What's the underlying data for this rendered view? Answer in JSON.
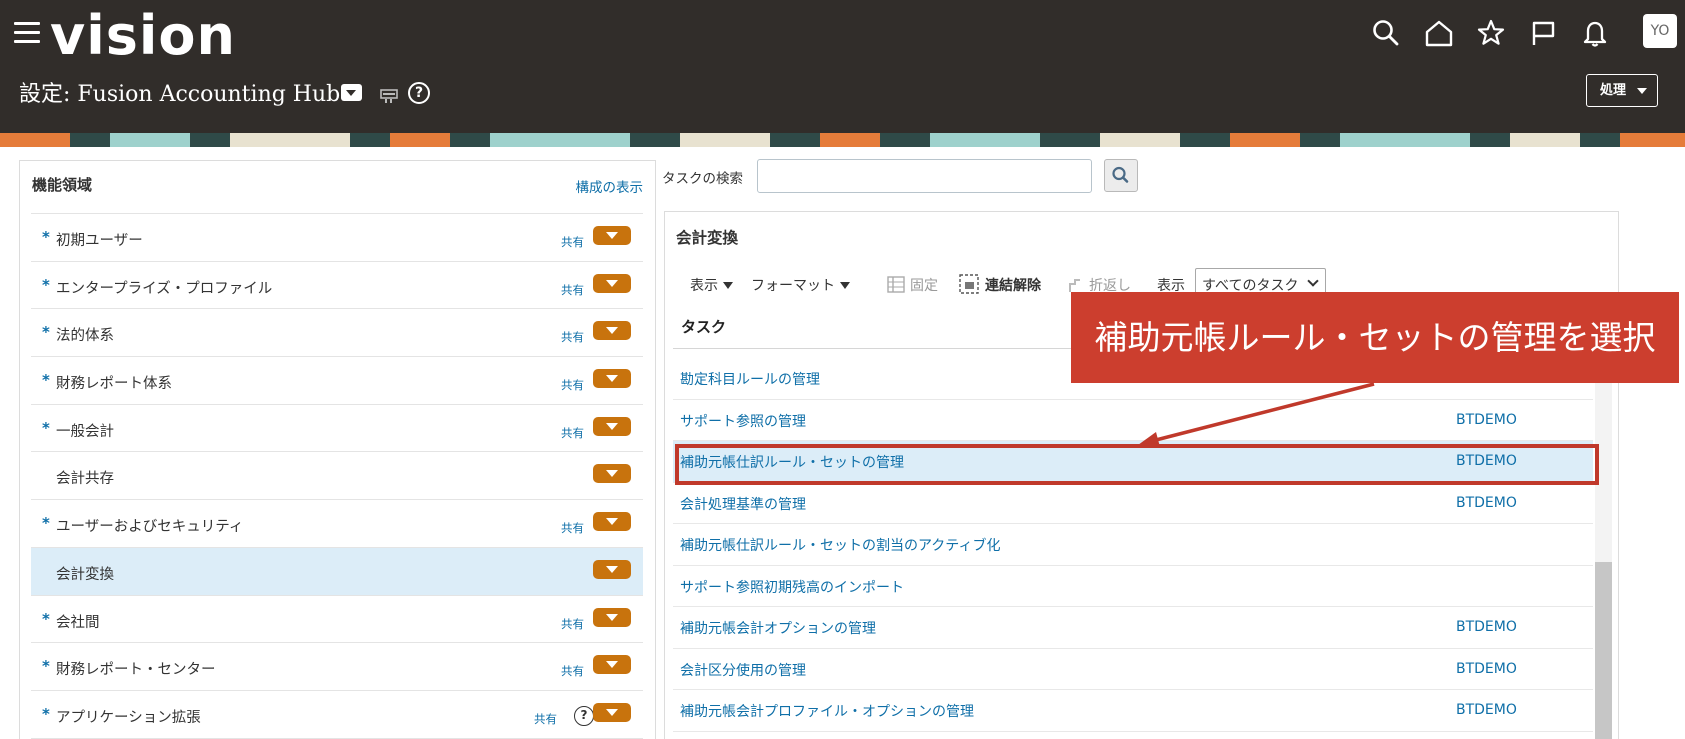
{
  "header": {
    "logo": "vision",
    "title": "設定: Fusion Accounting Hub",
    "avatar": "YO",
    "action_button": "処理",
    "icons": [
      "menu-icon",
      "search-icon",
      "home-icon",
      "favorites-icon",
      "flag-icon",
      "notifications-icon"
    ]
  },
  "left_panel": {
    "title": "機能領域",
    "show_config_link": "構成の表示",
    "items": [
      {
        "label": "初期ユーザー",
        "required": true,
        "shared": "共有"
      },
      {
        "label": "エンタープライズ・プロファイル",
        "required": true,
        "shared": "共有"
      },
      {
        "label": "法的体系",
        "required": true,
        "shared": "共有"
      },
      {
        "label": "財務レポート体系",
        "required": true,
        "shared": "共有"
      },
      {
        "label": "一般会計",
        "required": true,
        "shared": "共有"
      },
      {
        "label": "会計共存",
        "required": false,
        "shared": ""
      },
      {
        "label": "ユーザーおよびセキュリティ",
        "required": true,
        "shared": "共有"
      },
      {
        "label": "会計変換",
        "required": false,
        "shared": "",
        "selected": true
      },
      {
        "label": "会社間",
        "required": true,
        "shared": "共有"
      },
      {
        "label": "財務レポート・センター",
        "required": true,
        "shared": "共有"
      },
      {
        "label": "アプリケーション拡張",
        "required": true,
        "shared": "共有",
        "help": "?"
      }
    ],
    "star": "*",
    "accent_color": "#c8730d"
  },
  "search": {
    "label": "タスクの検索",
    "value": ""
  },
  "tasks_panel": {
    "title": "会計変換",
    "toolbar": {
      "view": "表示",
      "format": "フォーマット",
      "freeze": "固定",
      "detach": "連結解除",
      "wrap": "折返し",
      "show": "表示",
      "show_value": "すべてのタスク"
    },
    "column_task": "タスク",
    "rows": [
      {
        "name": "勘定科目ルールの管理",
        "owner": ""
      },
      {
        "name": "サポート参照の管理",
        "owner": "BTDEMO"
      },
      {
        "name": "補助元帳仕訳ルール・セットの管理",
        "owner": "BTDEMO",
        "selected": true
      },
      {
        "name": "会計処理基準の管理",
        "owner": "BTDEMO"
      },
      {
        "name": "補助元帳仕訳ルール・セットの割当のアクティブ化",
        "owner": ""
      },
      {
        "name": "サポート参照初期残高のインポート",
        "owner": ""
      },
      {
        "name": "補助元帳会計オプションの管理",
        "owner": "BTDEMO"
      },
      {
        "name": "会計区分使用の管理",
        "owner": "BTDEMO"
      },
      {
        "name": "補助元帳会計プロファイル・オプションの管理",
        "owner": "BTDEMO"
      }
    ]
  },
  "annotation": {
    "callout": "補助元帳ルール・セットの管理を選択",
    "color": "#cc3e2e"
  }
}
